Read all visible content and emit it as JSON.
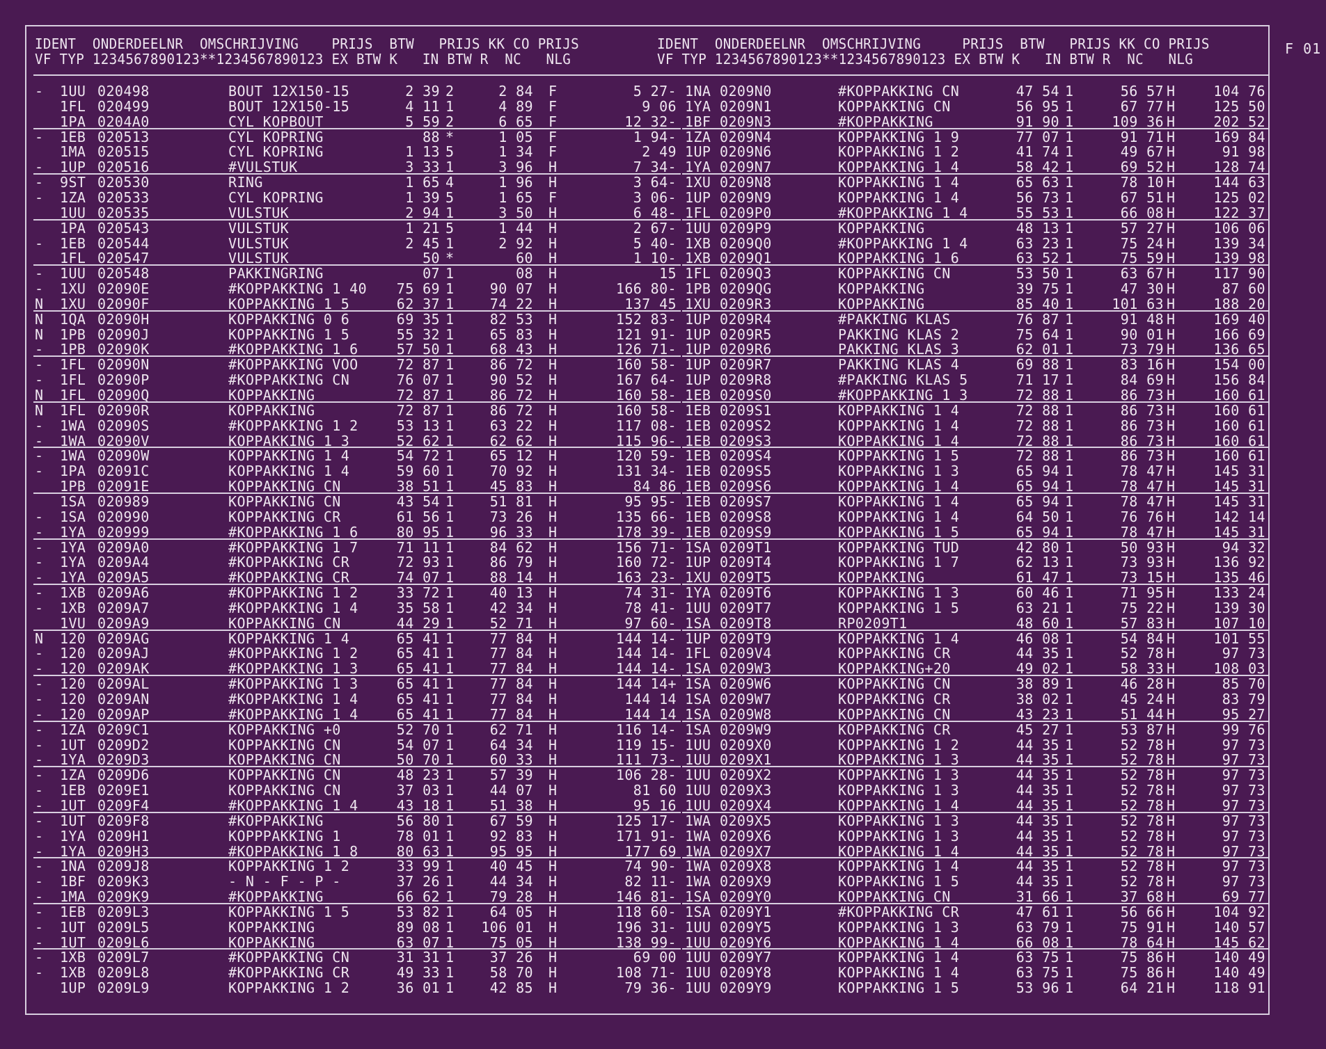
{
  "page_code": "F 01",
  "header": {
    "left_line1": "IDENT  ONDERDEELNR  OMSCHRIJVING    PRIJS  BTW   PRIJS KK CO PRIJS",
    "left_line2": "VF TYP 1234567890123**1234567890123 EX BTW K   IN BTW R  NC   NLG",
    "right_line1": "IDENT  ONDERDEELNR  OMSCHRIJVING     PRIJS  BTW   PRIJS KK CO PRIJS",
    "right_line2": "VF TYP 1234567890123**1234567890123 EX BTW K   IN BTW R  NC   NLG"
  },
  "left_rows": [
    [
      "-",
      "1UU",
      "020498",
      "BOUT 12X150-15",
      "2 39",
      "2",
      "2 84",
      "F",
      "5 27-"
    ],
    [
      "",
      "1FL",
      "020499",
      "BOUT 12X150-15",
      "4 11",
      "1",
      "4 89",
      "F",
      "9 06"
    ],
    [
      "",
      "1PA",
      "0204A0",
      "CYL KOPBOUT",
      "5 59",
      "2",
      "6 65",
      "F",
      "12 32-"
    ],
    [
      "-",
      "1EB",
      "020513",
      "CYL KOPRING",
      "88",
      "*",
      "1 05",
      "F",
      "1 94-"
    ],
    [
      "",
      "1MA",
      "020515",
      "CYL KOPRING",
      "1 13",
      "5",
      "1 34",
      "F",
      "2 49"
    ],
    [
      "-",
      "1UP",
      "020516",
      "#VULSTUK",
      "3 33",
      "1",
      "3 96",
      "H",
      "7 34-"
    ],
    [
      "-",
      "9ST",
      "020530",
      "RING",
      "1 65",
      "4",
      "1 96",
      "H",
      "3 64-"
    ],
    [
      "-",
      "1ZA",
      "020533",
      "CYL KOPRING",
      "1 39",
      "5",
      "1 65",
      "F",
      "3 06-"
    ],
    [
      "",
      "1UU",
      "020535",
      "VULSTUK",
      "2 94",
      "1",
      "3 50",
      "H",
      "6 48-"
    ],
    [
      "",
      "1PA",
      "020543",
      "VULSTUK",
      "1 21",
      "5",
      "1 44",
      "H",
      "2 67-"
    ],
    [
      "-",
      "1EB",
      "020544",
      "VULSTUK",
      "2 45",
      "1",
      "2 92",
      "H",
      "5 40-"
    ],
    [
      "",
      "1FL",
      "020547",
      "VULSTUK",
      "50",
      "*",
      "60",
      "H",
      "1 10-"
    ],
    [
      "-",
      "1UU",
      "020548",
      "PAKKINGRING",
      "07",
      "1",
      "08",
      "H",
      "15"
    ],
    [
      "-",
      "1XU",
      "02090E",
      "#KOPPAKKING 1 40",
      "75 69",
      "1",
      "90 07",
      "H",
      "166 80-"
    ],
    [
      "N",
      "1XU",
      "02090F",
      "KOPPAKKING 1 5",
      "62 37",
      "1",
      "74 22",
      "H",
      "137 45"
    ],
    [
      "N",
      "1QA",
      "02090H",
      "KOPPAKKING 0 6",
      "69 35",
      "1",
      "82 53",
      "H",
      "152 83-"
    ],
    [
      "N",
      "1PB",
      "02090J",
      "KOPPAKKING 1 5",
      "55 32",
      "1",
      "65 83",
      "H",
      "121 91-"
    ],
    [
      "-",
      "1PB",
      "02090K",
      "#KOPPAKKING 1 6",
      "57 50",
      "1",
      "68 43",
      "H",
      "126 71-"
    ],
    [
      "-",
      "1FL",
      "02090N",
      "#KOPPAKKING VOO",
      "72 87",
      "1",
      "86 72",
      "H",
      "160 58-"
    ],
    [
      "-",
      "1FL",
      "02090P",
      "#KOPPAKKING CN",
      "76 07",
      "1",
      "90 52",
      "H",
      "167 64-"
    ],
    [
      "N",
      "1FL",
      "02090Q",
      "KOPPAKKING",
      "72 87",
      "1",
      "86 72",
      "H",
      "160 58-"
    ],
    [
      "N",
      "1FL",
      "02090R",
      "KOPPAKKING",
      "72 87",
      "1",
      "86 72",
      "H",
      "160 58-"
    ],
    [
      "-",
      "1WA",
      "02090S",
      "#KOPPAKKING 1 2",
      "53 13",
      "1",
      "63 22",
      "H",
      "117 08-"
    ],
    [
      "-",
      "1WA",
      "02090V",
      "KOPPAKKING 1 3",
      "52 62",
      "1",
      "62 62",
      "H",
      "115 96-"
    ],
    [
      "-",
      "1WA",
      "02090W",
      "KOPPAKKING 1 4",
      "54 72",
      "1",
      "65 12",
      "H",
      "120 59-"
    ],
    [
      "-",
      "1PA",
      "02091C",
      "KOPPAKKING 1 4",
      "59 60",
      "1",
      "70 92",
      "H",
      "131 34-"
    ],
    [
      "",
      "1PB",
      "02091E",
      "KOPPAKKING CN",
      "38 51",
      "1",
      "45 83",
      "H",
      "84 86"
    ],
    [
      "",
      "1SA",
      "020989",
      "KOPPAKKING CN",
      "43 54",
      "1",
      "51 81",
      "H",
      "95 95-"
    ],
    [
      "-",
      "1SA",
      "020990",
      "KOPPAKKING CR",
      "61 56",
      "1",
      "73 26",
      "H",
      "135 66-"
    ],
    [
      "-",
      "1YA",
      "020999",
      "#KOPPAKKING 1 6",
      "80 95",
      "1",
      "96 33",
      "H",
      "178 39-"
    ],
    [
      "-",
      "1YA",
      "0209A0",
      "#KOPPAKKING 1 7",
      "71 11",
      "1",
      "84 62",
      "H",
      "156 71-"
    ],
    [
      "-",
      "1YA",
      "0209A4",
      "#KOPPAKKING CR",
      "72 93",
      "1",
      "86 79",
      "H",
      "160 72-"
    ],
    [
      "-",
      "1YA",
      "0209A5",
      "#KOPPAKKING CR",
      "74 07",
      "1",
      "88 14",
      "H",
      "163 23-"
    ],
    [
      "-",
      "1XB",
      "0209A6",
      "#KOPPAKKING 1 2",
      "33 72",
      "1",
      "40 13",
      "H",
      "74 31-"
    ],
    [
      "-",
      "1XB",
      "0209A7",
      "#KOPPAKKING 1 4",
      "35 58",
      "1",
      "42 34",
      "H",
      "78 41-"
    ],
    [
      "",
      "1VU",
      "0209A9",
      "KOPPAKKING CN",
      "44 29",
      "1",
      "52 71",
      "H",
      "97 60-"
    ],
    [
      "N",
      "120",
      "0209AG",
      "KOPPAKKING 1 4",
      "65 41",
      "1",
      "77 84",
      "H",
      "144 14-"
    ],
    [
      "-",
      "120",
      "0209AJ",
      "#KOPPAKKING 1 2",
      "65 41",
      "1",
      "77 84",
      "H",
      "144 14-"
    ],
    [
      "-",
      "120",
      "0209AK",
      "#KOPPAKKING 1 3",
      "65 41",
      "1",
      "77 84",
      "H",
      "144 14-"
    ],
    [
      "-",
      "120",
      "0209AL",
      "#KOPPAKKING 1 3",
      "65 41",
      "1",
      "77 84",
      "H",
      "144 14+"
    ],
    [
      "-",
      "120",
      "0209AN",
      "#KOPPAKKING 1 4",
      "65 41",
      "1",
      "77 84",
      "H",
      "144 14"
    ],
    [
      "-",
      "120",
      "0209AP",
      "#KOPPAKKING 1 4",
      "65 41",
      "1",
      "77 84",
      "H",
      "144 14"
    ],
    [
      "-",
      "1ZA",
      "0209C1",
      "KOPPAKKING +0",
      "52 70",
      "1",
      "62 71",
      "H",
      "116 14-"
    ],
    [
      "-",
      "1UT",
      "0209D2",
      "KOPPAKKING CN",
      "54 07",
      "1",
      "64 34",
      "H",
      "119 15-"
    ],
    [
      "-",
      "1YA",
      "0209D3",
      "KOPPAKKING CN",
      "50 70",
      "1",
      "60 33",
      "H",
      "111 73-"
    ],
    [
      "-",
      "1ZA",
      "0209D6",
      "KOPPAKKING CN",
      "48 23",
      "1",
      "57 39",
      "H",
      "106 28-"
    ],
    [
      "-",
      "1EB",
      "0209E1",
      "KOPPAKKING CN",
      "37 03",
      "1",
      "44 07",
      "H",
      "81 60"
    ],
    [
      "-",
      "1UT",
      "0209F4",
      "#KOPPAKKING 1 4",
      "43 18",
      "1",
      "51 38",
      "H",
      "95 16"
    ],
    [
      "-",
      "1UT",
      "0209F8",
      "#KOPPAKKING",
      "56 80",
      "1",
      "67 59",
      "H",
      "125 17-"
    ],
    [
      "-",
      "1YA",
      "0209H1",
      "KOPPPAKKING 1",
      "78 01",
      "1",
      "92 83",
      "H",
      "171 91-"
    ],
    [
      "-",
      "1YA",
      "0209H3",
      "#KOPPAKKING 1 8",
      "80 63",
      "1",
      "95 95",
      "H",
      "177 69"
    ],
    [
      "-",
      "1NA",
      "0209J8",
      "KOPPAKKING 1 2",
      "33 99",
      "1",
      "40 45",
      "H",
      "74 90-"
    ],
    [
      "-",
      "1BF",
      "0209K3",
      "- N - F - P -",
      "37 26",
      "1",
      "44 34",
      "H",
      "82 11-"
    ],
    [
      "-",
      "1MA",
      "0209K9",
      "#KOPPAKKING",
      "66 62",
      "1",
      "79 28",
      "H",
      "146 81-"
    ],
    [
      "-",
      "1EB",
      "0209L3",
      "KOPPAKKING 1 5",
      "53 82",
      "1",
      "64 05",
      "H",
      "118 60-"
    ],
    [
      "-",
      "1UT",
      "0209L5",
      "KOPPAKKING",
      "89 08",
      "1",
      "106 01",
      "H",
      "196 31-"
    ],
    [
      "-",
      "1UT",
      "0209L6",
      "KOPPAKKING",
      "63 07",
      "1",
      "75 05",
      "H",
      "138 99-"
    ],
    [
      "-",
      "1XB",
      "0209L7",
      "#KOPPAKKING CN",
      "31 31",
      "1",
      "37 26",
      "H",
      "69 00"
    ],
    [
      "-",
      "1XB",
      "0209L8",
      "#KOPPAKKING CR",
      "49 33",
      "1",
      "58 70",
      "H",
      "108 71-"
    ],
    [
      "",
      "1UP",
      "0209L9",
      "KOPPAKKING 1 2",
      "36 01",
      "1",
      "42 85",
      "H",
      "79 36-"
    ]
  ],
  "right_rows": [
    [
      "1NA",
      "0209N0",
      "#KOPPAKKING CN",
      "47 54",
      "1",
      "56 57",
      "H",
      "104 76"
    ],
    [
      "1YA",
      "0209N1",
      "KOPPAKKING CN",
      "56 95",
      "1",
      "67 77",
      "H",
      "125 50"
    ],
    [
      "1BF",
      "0209N3",
      "#KOPPAKKING",
      "91 90",
      "1",
      "109 36",
      "H",
      "202 52"
    ],
    [
      "1ZA",
      "0209N4",
      "KOPPAKKING 1 9",
      "77 07",
      "1",
      "91 71",
      "H",
      "169 84"
    ],
    [
      "1UP",
      "0209N6",
      "KOPPAKKING 1 2",
      "41 74",
      "1",
      "49 67",
      "H",
      "91 98"
    ],
    [
      "1YA",
      "0209N7",
      "KOPPAKKING 1 4",
      "58 42",
      "1",
      "69 52",
      "H",
      "128 74"
    ],
    [
      "1XU",
      "0209N8",
      "KOPPAKKING 1 4",
      "65 63",
      "1",
      "78 10",
      "H",
      "144 63"
    ],
    [
      "1UP",
      "0209N9",
      "KOPPAKKING 1 4",
      "56 73",
      "1",
      "67 51",
      "H",
      "125 02"
    ],
    [
      "1FL",
      "0209P0",
      "#KOPPAKKING 1 4",
      "55 53",
      "1",
      "66 08",
      "H",
      "122 37"
    ],
    [
      "1UU",
      "0209P9",
      "KOPPAKKING",
      "48 13",
      "1",
      "57 27",
      "H",
      "106 06"
    ],
    [
      "1XB",
      "0209Q0",
      "#KOPPAKKING 1 4",
      "63 23",
      "1",
      "75 24",
      "H",
      "139 34"
    ],
    [
      "1XB",
      "0209Q1",
      "KOPPAKKING 1 6",
      "63 52",
      "1",
      "75 59",
      "H",
      "139 98"
    ],
    [
      "1FL",
      "0209Q3",
      "KOPPAKKING CN",
      "53 50",
      "1",
      "63 67",
      "H",
      "117 90"
    ],
    [
      "1PB",
      "0209QG",
      "KOPPAKKING",
      "39 75",
      "1",
      "47 30",
      "H",
      "87 60"
    ],
    [
      "1XU",
      "0209R3",
      "KOPPAKKING",
      "85 40",
      "1",
      "101 63",
      "H",
      "188 20"
    ],
    [
      "1UP",
      "0209R4",
      "#PAKKING KLAS",
      "76 87",
      "1",
      "91 48",
      "H",
      "169 40"
    ],
    [
      "1UP",
      "0209R5",
      "PAKKING KLAS 2",
      "75 64",
      "1",
      "90 01",
      "H",
      "166 69"
    ],
    [
      "1UP",
      "0209R6",
      "PAKKING KLAS 3",
      "62 01",
      "1",
      "73 79",
      "H",
      "136 65"
    ],
    [
      "1UP",
      "0209R7",
      "PAKKING KLAS 4",
      "69 88",
      "1",
      "83 16",
      "H",
      "154 00"
    ],
    [
      "1UP",
      "0209R8",
      "#PAKKING KLAS 5",
      "71 17",
      "1",
      "84 69",
      "H",
      "156 84"
    ],
    [
      "1EB",
      "0209S0",
      "#KOPPAKKING 1 3",
      "72 88",
      "1",
      "86 73",
      "H",
      "160 61"
    ],
    [
      "1EB",
      "0209S1",
      "KOPPAKKING 1 4",
      "72 88",
      "1",
      "86 73",
      "H",
      "160 61"
    ],
    [
      "1EB",
      "0209S2",
      "KOPPAKKING 1 4",
      "72 88",
      "1",
      "86 73",
      "H",
      "160 61"
    ],
    [
      "1EB",
      "0209S3",
      "KOPPAKKING 1 4",
      "72 88",
      "1",
      "86 73",
      "H",
      "160 61"
    ],
    [
      "1EB",
      "0209S4",
      "KOPPAKKING 1 5",
      "72 88",
      "1",
      "86 73",
      "H",
      "160 61"
    ],
    [
      "1EB",
      "0209S5",
      "KOPPAKKING 1 3",
      "65 94",
      "1",
      "78 47",
      "H",
      "145 31"
    ],
    [
      "1EB",
      "0209S6",
      "KOPPAKKING 1 4",
      "65 94",
      "1",
      "78 47",
      "H",
      "145 31"
    ],
    [
      "1EB",
      "0209S7",
      "KOPPAKKING 1 4",
      "65 94",
      "1",
      "78 47",
      "H",
      "145 31"
    ],
    [
      "1EB",
      "0209S8",
      "KOPPAKKING 1 4",
      "64 50",
      "1",
      "76 76",
      "H",
      "142 14"
    ],
    [
      "1EB",
      "0209S9",
      "KOPPAKKING 1 5",
      "65 94",
      "1",
      "78 47",
      "H",
      "145 31"
    ],
    [
      "1SA",
      "0209T1",
      "KOPPAKKING TUD",
      "42 80",
      "1",
      "50 93",
      "H",
      "94 32"
    ],
    [
      "1UP",
      "0209T4",
      "KOPPAKKING 1 7",
      "62 13",
      "1",
      "73 93",
      "H",
      "136 92"
    ],
    [
      "1XU",
      "0209T5",
      "KOPPAKKING",
      "61 47",
      "1",
      "73 15",
      "H",
      "135 46"
    ],
    [
      "1YA",
      "0209T6",
      "KOPPAKKING 1 3",
      "60 46",
      "1",
      "71 95",
      "H",
      "133 24"
    ],
    [
      "1UU",
      "0209T7",
      "KOPPAKKING 1 5",
      "63 21",
      "1",
      "75 22",
      "H",
      "139 30"
    ],
    [
      "1SA",
      "0209T8",
      "RP0209T1",
      "48 60",
      "1",
      "57 83",
      "H",
      "107 10"
    ],
    [
      "1UP",
      "0209T9",
      "KOPPAKKING 1 4",
      "46 08",
      "1",
      "54 84",
      "H",
      "101 55"
    ],
    [
      "1FL",
      "0209V4",
      "KOPPAKKING CR",
      "44 35",
      "1",
      "52 78",
      "H",
      "97 73"
    ],
    [
      "1SA",
      "0209W3",
      "KOPPAKKING+20",
      "49 02",
      "1",
      "58 33",
      "H",
      "108 03"
    ],
    [
      "1SA",
      "0209W6",
      "KOPPAKKING CN",
      "38 89",
      "1",
      "46 28",
      "H",
      "85 70"
    ],
    [
      "1SA",
      "0209W7",
      "KOPPAKKING CR",
      "38 02",
      "1",
      "45 24",
      "H",
      "83 79"
    ],
    [
      "1SA",
      "0209W8",
      "KOPPAKKING CN",
      "43 23",
      "1",
      "51 44",
      "H",
      "95 27"
    ],
    [
      "1SA",
      "0209W9",
      "KOPPAKKING CR",
      "45 27",
      "1",
      "53 87",
      "H",
      "99 76"
    ],
    [
      "1UU",
      "0209X0",
      "KOPPAKKING 1 2",
      "44 35",
      "1",
      "52 78",
      "H",
      "97 73"
    ],
    [
      "1UU",
      "0209X1",
      "KOPPAKKING 1 3",
      "44 35",
      "1",
      "52 78",
      "H",
      "97 73"
    ],
    [
      "1UU",
      "0209X2",
      "KOPPAKKING 1 3",
      "44 35",
      "1",
      "52 78",
      "H",
      "97 73"
    ],
    [
      "1UU",
      "0209X3",
      "KOPPAKKING 1 3",
      "44 35",
      "1",
      "52 78",
      "H",
      "97 73"
    ],
    [
      "1UU",
      "0209X4",
      "KOPPAKKING 1 4",
      "44 35",
      "1",
      "52 78",
      "H",
      "97 73"
    ],
    [
      "1WA",
      "0209X5",
      "KOPPAKKING 1 3",
      "44 35",
      "1",
      "52 78",
      "H",
      "97 73"
    ],
    [
      "1WA",
      "0209X6",
      "KOPPAKKING 1 3",
      "44 35",
      "1",
      "52 78",
      "H",
      "97 73"
    ],
    [
      "1WA",
      "0209X7",
      "KOPPAKKING 1 4",
      "44 35",
      "1",
      "52 78",
      "H",
      "97 73"
    ],
    [
      "1WA",
      "0209X8",
      "KOPPAKKING 1 4",
      "44 35",
      "1",
      "52 78",
      "H",
      "97 73"
    ],
    [
      "1WA",
      "0209X9",
      "KOPPAKKING 1 5",
      "44 35",
      "1",
      "52 78",
      "H",
      "97 73"
    ],
    [
      "1SA",
      "0209Y0",
      "KOPPAKKING CN",
      "31 66",
      "1",
      "37 68",
      "H",
      "69 77"
    ],
    [
      "1SA",
      "0209Y1",
      "#KOPPAKKING CR",
      "47 61",
      "1",
      "56 66",
      "H",
      "104 92"
    ],
    [
      "1UU",
      "0209Y5",
      "KOPPAKKING 1 3",
      "63 79",
      "1",
      "75 91",
      "H",
      "140 57"
    ],
    [
      "1UU",
      "0209Y6",
      "KOPPAKKING 1 4",
      "66 08",
      "1",
      "78 64",
      "H",
      "145 62"
    ],
    [
      "1UU",
      "0209Y7",
      "KOPPAKKING 1 4",
      "63 75",
      "1",
      "75 86",
      "H",
      "140 49"
    ],
    [
      "1UU",
      "0209Y8",
      "KOPPAKKING 1 4",
      "63 75",
      "1",
      "75 86",
      "H",
      "140 49"
    ],
    [
      "1UU",
      "0209Y9",
      "KOPPAKKING 1 5",
      "53 96",
      "1",
      "64 21",
      "H",
      "118 91"
    ]
  ]
}
